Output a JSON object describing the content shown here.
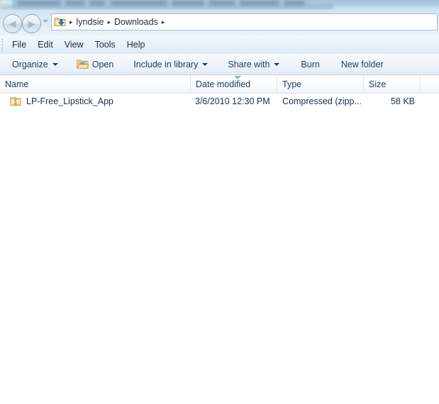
{
  "window": {
    "title_blurred": true
  },
  "navigation": {
    "back_button": "Back",
    "forward_button": "Forward",
    "recent_pages_label": "Recent pages",
    "address": {
      "icon": "downloads-folder-icon",
      "separator": "▸",
      "crumbs": [
        "lyndsie",
        "Downloads"
      ]
    }
  },
  "menu": {
    "items": [
      {
        "label": "File"
      },
      {
        "label": "Edit"
      },
      {
        "label": "View"
      },
      {
        "label": "Tools"
      },
      {
        "label": "Help"
      }
    ]
  },
  "toolbar": {
    "items": [
      {
        "label": "Organize",
        "caret": true,
        "icon": null
      },
      {
        "label": "Open",
        "caret": false,
        "icon": "open-folder-icon"
      },
      {
        "label": "Include in library",
        "caret": true,
        "icon": null
      },
      {
        "label": "Share with",
        "caret": true,
        "icon": null
      },
      {
        "label": "Burn",
        "caret": false,
        "icon": null
      },
      {
        "label": "New folder",
        "caret": false,
        "icon": null
      }
    ]
  },
  "columns": [
    {
      "label": "Name"
    },
    {
      "label": "Date modified",
      "sorted": true,
      "sort_direction": "descending"
    },
    {
      "label": "Type"
    },
    {
      "label": "Size"
    }
  ],
  "files": [
    {
      "icon": "zipped-folder-icon",
      "name": "LP-Free_Lipstick_App",
      "date_modified": "3/6/2010 12:30 PM",
      "type": "Compressed (zipp...",
      "size": "58 KB"
    }
  ],
  "colors": {
    "aero_blue": "#cfe3f2",
    "text_blue": "#1c3d63",
    "accent_sort": "#8cb8dc",
    "folder_yellow": "#f3cf73",
    "arrow_blue": "#1e7fd6"
  }
}
